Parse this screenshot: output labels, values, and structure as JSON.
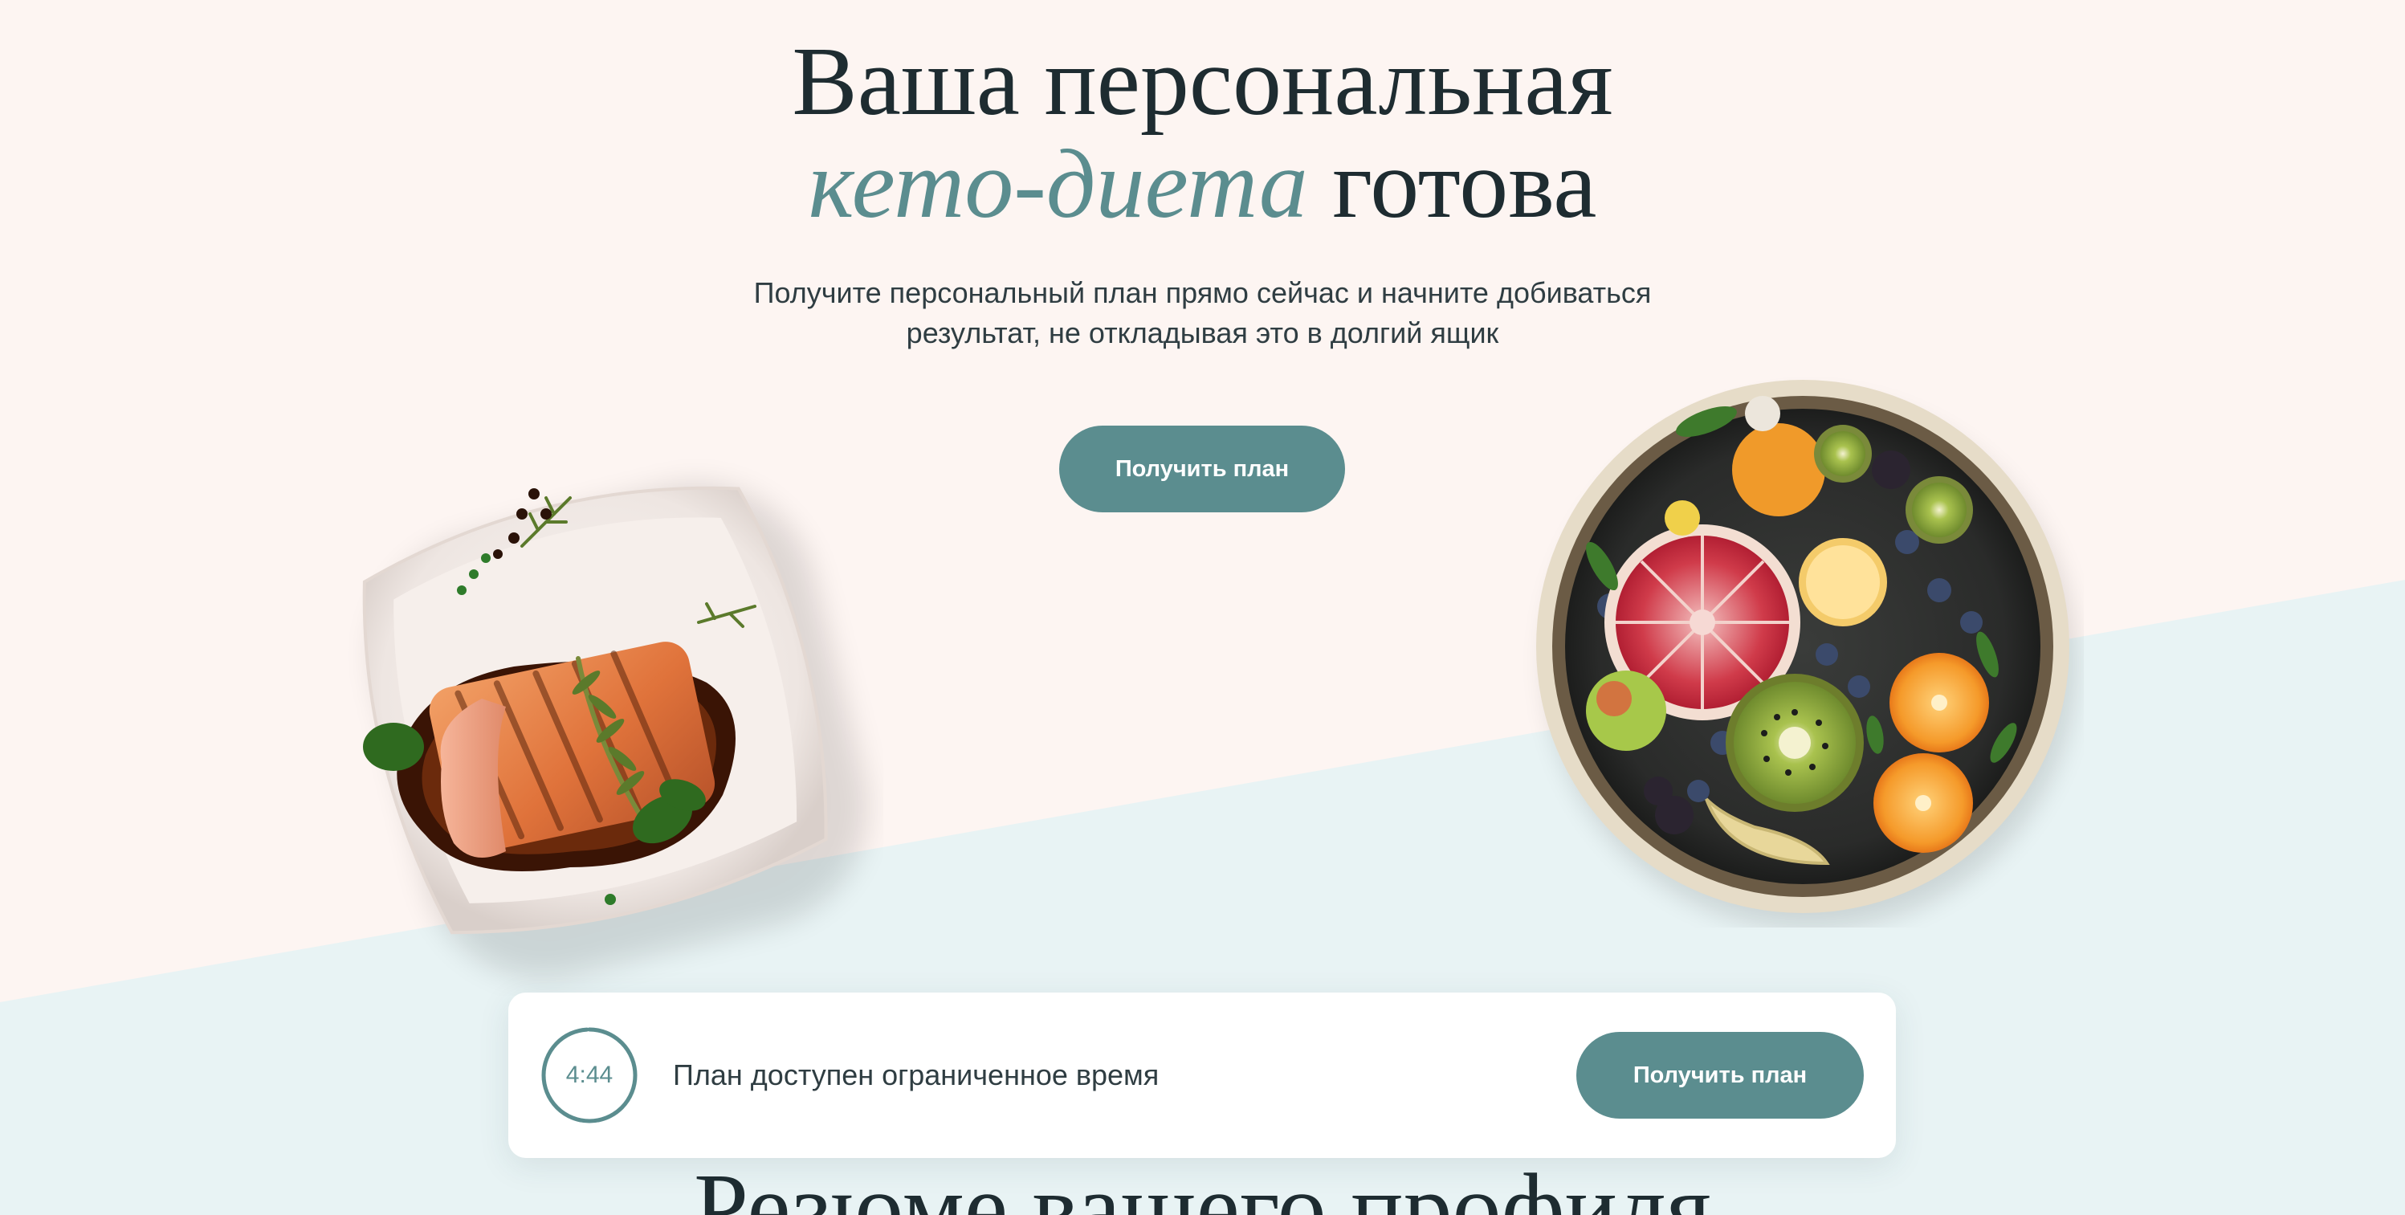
{
  "colors": {
    "page_background": "#fdf5f2",
    "lower_band": "#e8f3f4",
    "accent": "#5b8d8f",
    "heading_text": "#1e2c31",
    "body_text": "#2f3d42"
  },
  "hero": {
    "title_line1": "Ваша персональная",
    "title_accent": "кето-диета",
    "title_rest": " готова",
    "subtitle_line1": "Получите персональный план прямо сейчас и начните добиваться",
    "subtitle_line2": "результат, не откладывая это в долгий ящик",
    "cta_label": "Получить план"
  },
  "images": {
    "left_plate": "salmon-steak-plate",
    "right_plate": "fruit-bowl"
  },
  "offer": {
    "timer": "4:44",
    "timer_progress_fraction": 0.99,
    "message": "План доступен ограниченное время",
    "cta_label": "Получить план"
  },
  "summary": {
    "heading": "Резюме вашего профиля"
  }
}
